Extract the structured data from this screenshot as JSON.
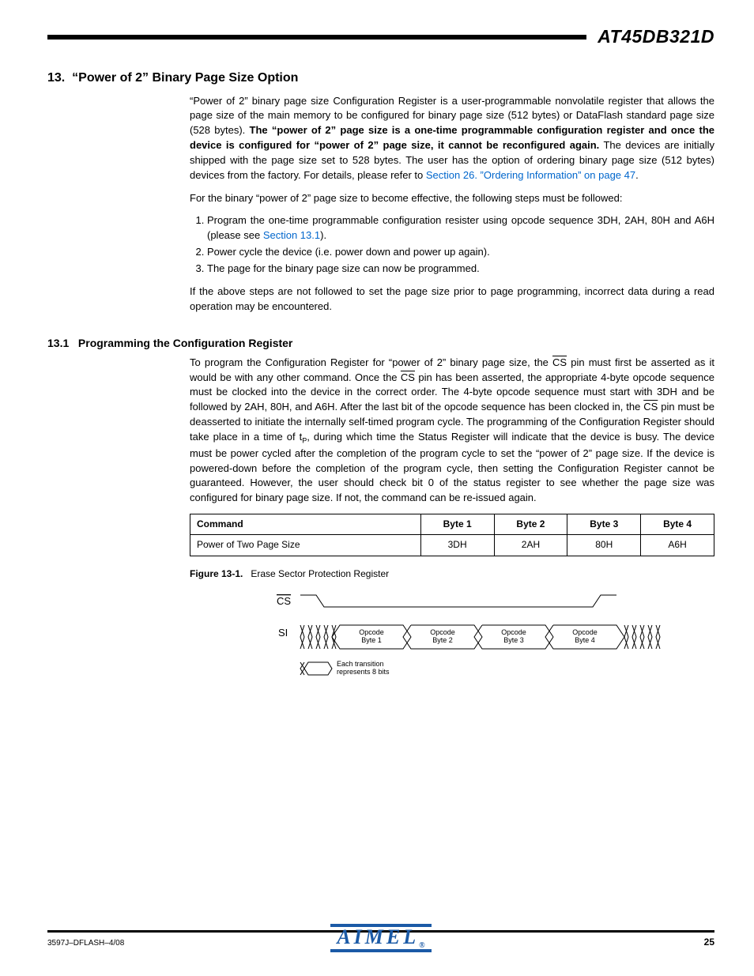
{
  "header": {
    "doc_title": "AT45DB321D"
  },
  "section": {
    "number": "13.",
    "title": "“Power of 2” Binary Page Size Option",
    "para1_a": "“Power of 2” binary page size Configuration Register is a user-programmable nonvolatile register that allows the page size of the main memory to be configured for binary page size (512 bytes) or DataFlash standard page size (528 bytes). ",
    "para1_bold": "The “power of 2” page size is a one-time programmable configuration register and once the device is configured for “power of 2” page size, it cannot be reconfigured again.",
    "para1_b": " The devices are initially shipped with the page size set to 528 bytes. The user has the option of ordering binary page size (512 bytes) devices from the factory. For details, please refer to ",
    "link1": "Section 26. ”Ordering Information” on page 47",
    "para2": "For  the binary “power of 2” page size to become effective, the following steps must be followed:",
    "steps": {
      "s1a": "Program the one-time programmable configuration resister using opcode sequence 3DH, 2AH, 80H and A6H (please see ",
      "s1link": "Section 13.1",
      "s1b": ").",
      "s2": "Power cycle the device (i.e. power down and power up again).",
      "s3": "The page for the binary page size can now be programmed."
    },
    "para3": "If the above steps are not followed to set the page size prior to page programming, incorrect data during a read operation may be encountered."
  },
  "subsection": {
    "number": "13.1",
    "title": "Programming the Configuration Register",
    "p_a": "To program the Configuration Register for “power of 2” binary page size, the ",
    "cs": "CS",
    "p_b": " pin must first be asserted as it would be with any other command. Once the ",
    "p_c": " pin has been asserted, the appropriate 4-byte opcode sequence must be clocked into the device in the correct order. The 4-byte opcode sequence must start with 3DH and be followed by 2AH, 80H, and A6H. After the last bit of the opcode sequence has been clocked in, the ",
    "p_d": " pin must be deasserted to initiate the internally self-timed program cycle. The programming of the Configuration Register should take place in a time of t",
    "sub": "P",
    "p_e": ", during which time the Status Register will indicate that the device is busy. The device must be power cycled after the completion of the program cycle to set the “power of 2” page size. If the device is powered-down before the completion of the program cycle, then setting the Configuration Register cannot be guaranteed. However, the user should check bit 0 of the status register to see whether the page size was configured for binary page size. If not, the command can be re-issued again."
  },
  "table": {
    "headers": [
      "Command",
      "Byte 1",
      "Byte 2",
      "Byte 3",
      "Byte 4"
    ],
    "row": [
      "Power of Two Page Size",
      "3DH",
      "2AH",
      "80H",
      "A6H"
    ]
  },
  "figure": {
    "label": "Figure 13-1.",
    "caption": "Erase Sector Protection Register",
    "cs_label": "CS",
    "si_label": "SI",
    "opcodes": [
      "Opcode Byte 1",
      "Opcode Byte 2",
      "Opcode Byte 3",
      "Opcode Byte 4"
    ],
    "note": "Each transition represents 8 bits"
  },
  "footer": {
    "docref": "3597J–DFLASH–4/08",
    "logo": "AIMEL",
    "page": "25"
  }
}
